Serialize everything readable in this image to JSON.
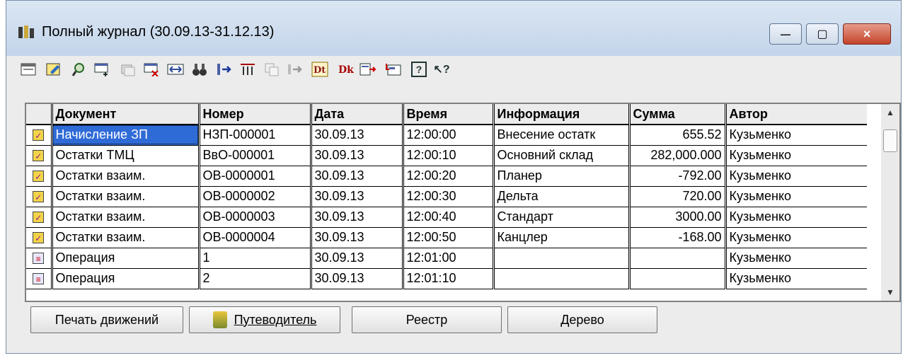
{
  "window": {
    "title": "Полный журнал (30.09.13-31.12.13)",
    "close_glyph": "×",
    "min_glyph": "—",
    "max_glyph": "▢"
  },
  "toolbar": {
    "icons": [
      "new-icon",
      "edit-icon",
      "find-icon",
      "add-row-icon",
      "copy-icon",
      "delete-icon",
      "width-icon",
      "binoculars-icon",
      "move-icon",
      "filter-icon",
      "copy-doc-icon",
      "arrow-icon",
      "dt-icon",
      "dk-icon",
      "export-icon",
      "tree-icon",
      "help-icon",
      "whats-this-icon"
    ],
    "help_glyph": "?",
    "whatsthis_glyph": "↖?"
  },
  "grid": {
    "columns": [
      "Документ",
      "Номер",
      "Дата",
      "Время",
      "Информация",
      "Сумма",
      "Автор"
    ],
    "rows": [
      {
        "type": "doc",
        "doc": "Начисление ЗП",
        "num": "НЗП-000001",
        "date": "30.09.13",
        "time": "12:00:00",
        "info": "Внесение остатк",
        "sum": "655.52",
        "author": "Кузьменко"
      },
      {
        "type": "doc",
        "doc": "Остатки ТМЦ",
        "num": "ВвО-000001",
        "date": "30.09.13",
        "time": "12:00:10",
        "info": "Основний склад",
        "sum": "282,000.000",
        "author": "Кузьменко"
      },
      {
        "type": "doc",
        "doc": "Остатки взаим.",
        "num": "ОВ-0000001",
        "date": "30.09.13",
        "time": "12:00:20",
        "info": "Планер",
        "sum": "-792.00",
        "author": "Кузьменко"
      },
      {
        "type": "doc",
        "doc": "Остатки взаим.",
        "num": "ОВ-0000002",
        "date": "30.09.13",
        "time": "12:00:30",
        "info": "Дельта",
        "sum": "720.00",
        "author": "Кузьменко"
      },
      {
        "type": "doc",
        "doc": "Остатки взаим.",
        "num": "ОВ-0000003",
        "date": "30.09.13",
        "time": "12:00:40",
        "info": "Стандарт",
        "sum": "3000.00",
        "author": "Кузьменко"
      },
      {
        "type": "doc",
        "doc": "Остатки взаим.",
        "num": "ОВ-0000004",
        "date": "30.09.13",
        "time": "12:00:50",
        "info": "Канцлер",
        "sum": "-168.00",
        "author": "Кузьменко"
      },
      {
        "type": "op",
        "doc": "Операция",
        "num": "1",
        "date": "30.09.13",
        "time": "12:01:00",
        "info": "",
        "sum": "",
        "author": "Кузьменко"
      },
      {
        "type": "op",
        "doc": "Операция",
        "num": "2",
        "date": "30.09.13",
        "time": "12:01:10",
        "info": "",
        "sum": "",
        "author": "Кузьменко"
      }
    ],
    "doc_icon_glyph": "✓",
    "op_icon_glyph": "≡",
    "scroll_up_glyph": "▲",
    "scroll_down_glyph": "▼"
  },
  "buttons": {
    "print": "Печать движений",
    "guide": "Путеводитель",
    "register": "Реестр",
    "tree": "Дерево"
  }
}
